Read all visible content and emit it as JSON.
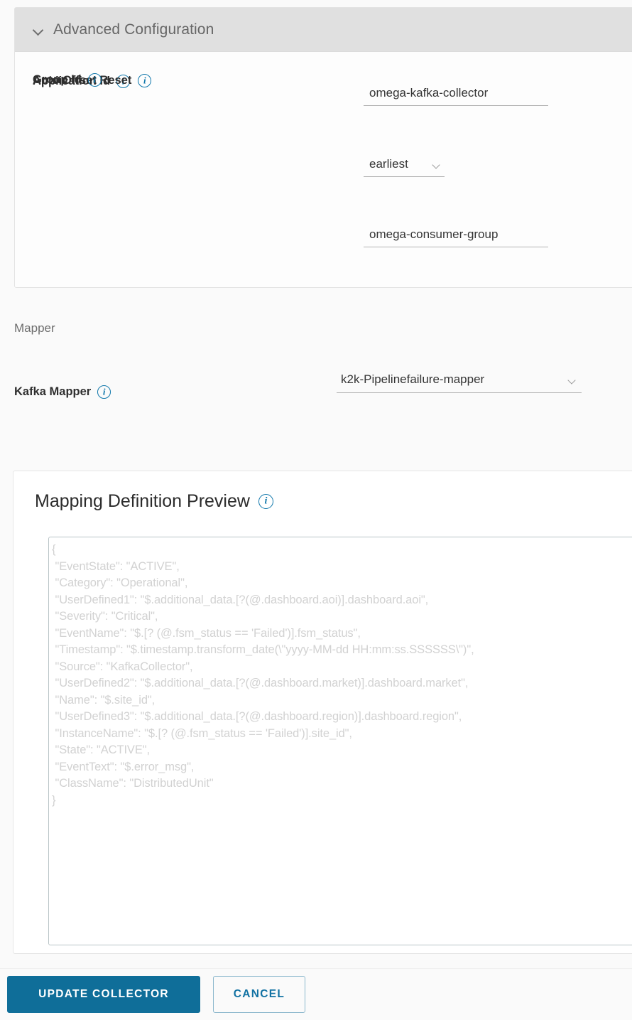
{
  "advanced": {
    "section_title": "Advanced Configuration",
    "collapse_icon": "chevron-down-icon",
    "fields": [
      {
        "label": "Application Id",
        "info_icon": "info-icon",
        "value": "omega-kafka-collector",
        "type": "text"
      },
      {
        "label": "Auto Offset Reset",
        "info_icon": "info-icon",
        "value": "earliest",
        "type": "select"
      },
      {
        "label": "Group Id",
        "info_icon": "info-icon",
        "value": "omega-consumer-group",
        "type": "text"
      }
    ]
  },
  "mapper": {
    "heading": "Mapper",
    "kafka_mapper_label": "Kafka Mapper",
    "kafka_mapper_value": "k2k-Pipelinefailure-mapper",
    "info_icon": "info-icon",
    "dropdown_icon": "chevron-down-icon"
  },
  "preview": {
    "title": "Mapping Definition Preview",
    "info_icon": "info-icon",
    "content": "{\n \"EventState\": \"ACTIVE\",\n \"Category\": \"Operational\",\n \"UserDefined1\": \"$.additional_data.[?(@.dashboard.aoi)].dashboard.aoi\",\n \"Severity\": \"Critical\",\n \"EventName\": \"$.[? (@.fsm_status == 'Failed')].fsm_status\",\n \"Timestamp\": \"$.timestamp.transform_date(\\\"yyyy-MM-dd HH:mm:ss.SSSSSS\\\")\",\n \"Source\": \"KafkaCollector\",\n \"UserDefined2\": \"$.additional_data.[?(@.dashboard.market)].dashboard.market\",\n \"Name\": \"$.site_id\",\n \"UserDefined3\": \"$.additional_data.[?(@.dashboard.region)].dashboard.region\",\n \"InstanceName\": \"$.[? (@.fsm_status == 'Failed')].site_id\",\n \"State\": \"ACTIVE\",\n \"EventText\": \"$.error_msg\",\n \"ClassName\": \"DistributedUnit\"\n}"
  },
  "footer": {
    "primary_label": "UPDATE COLLECTOR",
    "secondary_label": "CANCEL"
  },
  "colors": {
    "primary_button": "#0f6e99",
    "link_blue": "#1272a3",
    "info_icon_blue": "#0f77ab",
    "header_bg": "#e0e0e0",
    "page_bg": "#fafafa",
    "preview_text": "#d2d2d2"
  }
}
